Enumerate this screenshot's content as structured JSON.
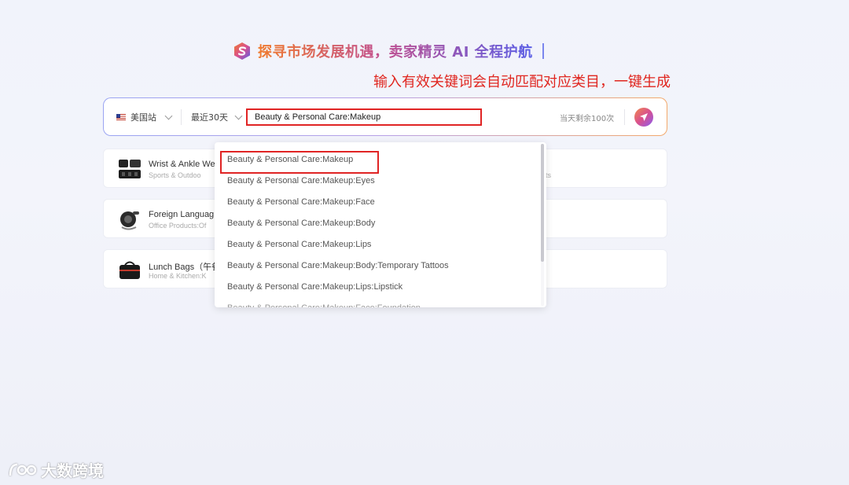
{
  "hero": {
    "title": "探寻市场发展机遇，卖家精灵 AI 全程护航"
  },
  "annotation": {
    "text": "输入有效关键词会自动匹配对应类目，一键生成"
  },
  "search": {
    "site_label": "美国站",
    "range_label": "最近30天",
    "keyword_value": "Beauty & Personal Care:Makeup",
    "quota_text": "当天剩余100次"
  },
  "cards": [
    {
      "title": "Wrist & Ankle We",
      "sub": "Sports & Outdoo"
    },
    {
      "title": "Foreign Languag",
      "sub": "Office Products:Of"
    },
    {
      "title": "Lunch Bags（午餐",
      "sub": "Home & Kitchen:K"
    }
  ],
  "card_right_sub": "ts",
  "dropdown": {
    "items": [
      "Beauty & Personal Care:Makeup",
      "Beauty & Personal Care:Makeup:Eyes",
      "Beauty & Personal Care:Makeup:Face",
      "Beauty & Personal Care:Makeup:Body",
      "Beauty & Personal Care:Makeup:Lips",
      "Beauty & Personal Care:Makeup:Body:Temporary Tattoos",
      "Beauty & Personal Care:Makeup:Lips:Lipstick",
      "Beauty & Personal Care:Makeup:Face:Foundation"
    ]
  },
  "watermark": {
    "text": "大数跨境"
  },
  "colors": {
    "accent_red": "#e02424",
    "gradient_start": "#f07a2d",
    "gradient_end": "#5a5ee6"
  }
}
